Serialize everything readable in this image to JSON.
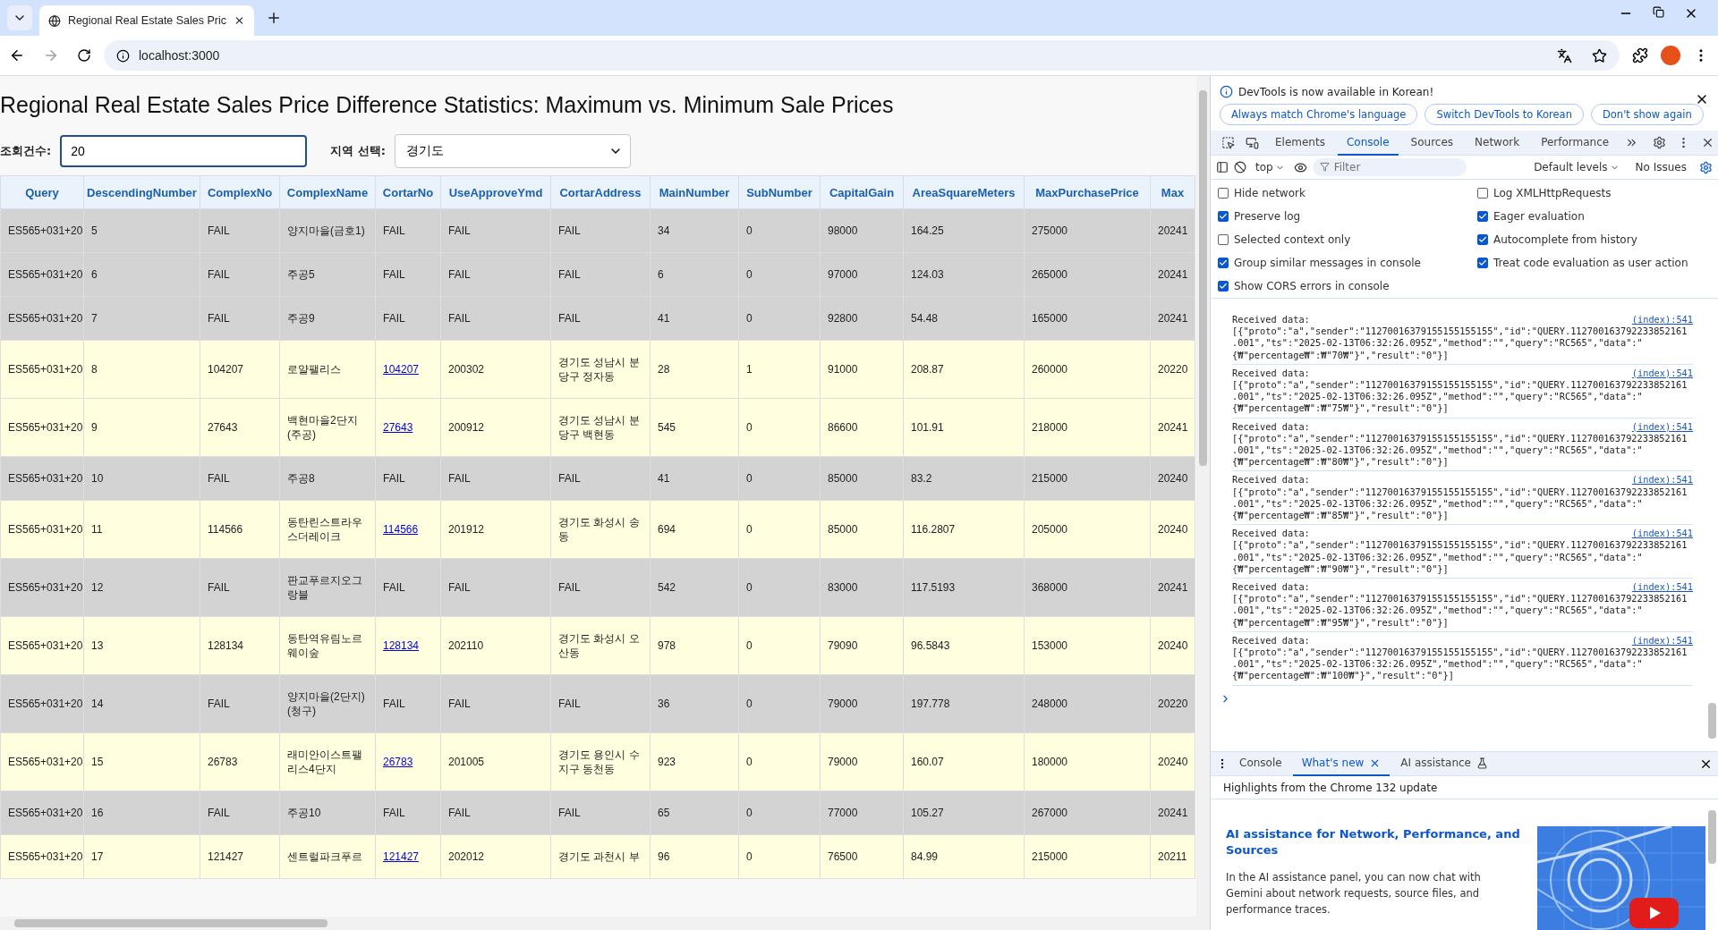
{
  "browser": {
    "tab_title": "Regional Real Estate Sales Pric",
    "url": "localhost:3000"
  },
  "page": {
    "title": "Regional Real Estate Sales Price Difference Statistics: Maximum vs. Minimum Sale Prices",
    "count_label": "조회건수:",
    "count_value": "20",
    "region_label": "지역 선택:",
    "region_value": "경기도"
  },
  "table": {
    "columns": [
      "Query",
      "DescendingNumber",
      "ComplexNo",
      "ComplexName",
      "CortarNo",
      "UseApproveYmd",
      "CortarAddress",
      "MainNumber",
      "SubNumber",
      "CapitalGain",
      "AreaSquareMeters",
      "MaxPurchasePrice",
      "Max"
    ],
    "rows": [
      {
        "kind": "fail",
        "cells": [
          "ES565+031+20",
          "5",
          "FAIL",
          "양지마을(금호1)",
          "FAIL",
          "FAIL",
          "FAIL",
          "34",
          "0",
          "98000",
          "164.25",
          "275000",
          "20241"
        ]
      },
      {
        "kind": "fail",
        "cells": [
          "ES565+031+20",
          "6",
          "FAIL",
          "주공5",
          "FAIL",
          "FAIL",
          "FAIL",
          "6",
          "0",
          "97000",
          "124.03",
          "265000",
          "20241"
        ]
      },
      {
        "kind": "fail",
        "cells": [
          "ES565+031+20",
          "7",
          "FAIL",
          "주공9",
          "FAIL",
          "FAIL",
          "FAIL",
          "41",
          "0",
          "92800",
          "54.48",
          "165000",
          "20241"
        ]
      },
      {
        "kind": "ok",
        "cells": [
          "ES565+031+20",
          "8",
          "104207",
          "로얄팰리스",
          "104207",
          "200302",
          "경기도 성남시 분당구 정자동",
          "28",
          "1",
          "91000",
          "208.87",
          "260000",
          "20220"
        ]
      },
      {
        "kind": "ok",
        "cells": [
          "ES565+031+20",
          "9",
          "27643",
          "백현마을2단지(주공)",
          "27643",
          "200912",
          "경기도 성남시 분당구 백현동",
          "545",
          "0",
          "86600",
          "101.91",
          "218000",
          "20241"
        ]
      },
      {
        "kind": "fail",
        "cells": [
          "ES565+031+20",
          "10",
          "FAIL",
          "주공8",
          "FAIL",
          "FAIL",
          "FAIL",
          "41",
          "0",
          "85000",
          "83.2",
          "215000",
          "20240"
        ]
      },
      {
        "kind": "ok",
        "cells": [
          "ES565+031+20",
          "11",
          "114566",
          "동탄린스트라우스더레이크",
          "114566",
          "201912",
          "경기도 화성시 송동",
          "694",
          "0",
          "85000",
          "116.2807",
          "205000",
          "20240"
        ]
      },
      {
        "kind": "fail",
        "cells": [
          "ES565+031+20",
          "12",
          "FAIL",
          "판교푸르지오그랑블",
          "FAIL",
          "FAIL",
          "FAIL",
          "542",
          "0",
          "83000",
          "117.5193",
          "368000",
          "20241"
        ]
      },
      {
        "kind": "ok",
        "cells": [
          "ES565+031+20",
          "13",
          "128134",
          "동탄역유림노르웨이숲",
          "128134",
          "202110",
          "경기도 화성시 오산동",
          "978",
          "0",
          "79090",
          "96.5843",
          "153000",
          "20240"
        ]
      },
      {
        "kind": "fail",
        "cells": [
          "ES565+031+20",
          "14",
          "FAIL",
          "양지마을(2단지)(청구)",
          "FAIL",
          "FAIL",
          "FAIL",
          "36",
          "0",
          "79000",
          "197.778",
          "248000",
          "20220"
        ]
      },
      {
        "kind": "ok",
        "cells": [
          "ES565+031+20",
          "15",
          "26783",
          "래미안이스트팰리스4단지",
          "26783",
          "201005",
          "경기도 용인시 수지구 동천동",
          "923",
          "0",
          "79000",
          "160.07",
          "180000",
          "20240"
        ]
      },
      {
        "kind": "fail",
        "cells": [
          "ES565+031+20",
          "16",
          "FAIL",
          "주공10",
          "FAIL",
          "FAIL",
          "FAIL",
          "65",
          "0",
          "77000",
          "105.27",
          "267000",
          "20241"
        ]
      },
      {
        "kind": "ok",
        "cells": [
          "ES565+031+20",
          "17",
          "121427",
          "센트럴파크푸르",
          "121427",
          "202012",
          "경기도 과천시 부",
          "96",
          "0",
          "76500",
          "84.99",
          "215000",
          "20211"
        ]
      }
    ]
  },
  "devtools": {
    "infobar": {
      "message": "DevTools is now available in Korean!",
      "buttons": [
        "Always match Chrome's language",
        "Switch DevTools to Korean",
        "Don't show again"
      ]
    },
    "tabs": [
      {
        "label": "Elements",
        "selected": false
      },
      {
        "label": "Console",
        "selected": true
      },
      {
        "label": "Sources",
        "selected": false
      },
      {
        "label": "Network",
        "selected": false
      },
      {
        "label": "Performance",
        "selected": false
      }
    ],
    "toolbar": {
      "context": "top",
      "filter_placeholder": "Filter",
      "levels": "Default levels",
      "issues": "No Issues"
    },
    "settings": [
      {
        "label": "Hide network",
        "checked": false
      },
      {
        "label": "Preserve log",
        "checked": true
      },
      {
        "label": "Selected context only",
        "checked": false
      },
      {
        "label": "Group similar messages in console",
        "checked": true
      },
      {
        "label": "Show CORS errors in console",
        "checked": true
      },
      {
        "label": "Log XMLHttpRequests",
        "checked": false
      },
      {
        "label": "Eager evaluation",
        "checked": true
      },
      {
        "label": "Autocomplete from history",
        "checked": true
      },
      {
        "label": "Treat code evaluation as user action",
        "checked": true
      }
    ],
    "messages": [
      {
        "label": "Received data:",
        "source": "(index):541",
        "lines": [
          "[{\"proto\":\"a\",\"sender\":\"11270016379155155155155\",\"id\":\"QUERY.112700163792233852161",
          ".001\",\"ts\":\"2025-02-13T06:32:26.095Z\",\"method\":\"\",\"query\":\"RC565\",\"data\":\"",
          "{₩\"percentage₩\":₩\"70₩\"}\",\"result\":\"0\"}]"
        ]
      },
      {
        "label": "Received data:",
        "source": "(index):541",
        "lines": [
          "[{\"proto\":\"a\",\"sender\":\"11270016379155155155155\",\"id\":\"QUERY.112700163792233852161",
          ".001\",\"ts\":\"2025-02-13T06:32:26.095Z\",\"method\":\"\",\"query\":\"RC565\",\"data\":\"",
          "{₩\"percentage₩\":₩\"75₩\"}\",\"result\":\"0\"}]"
        ]
      },
      {
        "label": "Received data:",
        "source": "(index):541",
        "lines": [
          "[{\"proto\":\"a\",\"sender\":\"11270016379155155155155\",\"id\":\"QUERY.112700163792233852161",
          ".001\",\"ts\":\"2025-02-13T06:32:26.095Z\",\"method\":\"\",\"query\":\"RC565\",\"data\":\"",
          "{₩\"percentage₩\":₩\"80₩\"}\",\"result\":\"0\"}]"
        ]
      },
      {
        "label": "Received data:",
        "source": "(index):541",
        "lines": [
          "[{\"proto\":\"a\",\"sender\":\"11270016379155155155155\",\"id\":\"QUERY.112700163792233852161",
          ".001\",\"ts\":\"2025-02-13T06:32:26.095Z\",\"method\":\"\",\"query\":\"RC565\",\"data\":\"",
          "{₩\"percentage₩\":₩\"85₩\"}\",\"result\":\"0\"}]"
        ]
      },
      {
        "label": "Received data:",
        "source": "(index):541",
        "lines": [
          "[{\"proto\":\"a\",\"sender\":\"11270016379155155155155\",\"id\":\"QUERY.112700163792233852161",
          ".001\",\"ts\":\"2025-02-13T06:32:26.095Z\",\"method\":\"\",\"query\":\"RC565\",\"data\":\"",
          "{₩\"percentage₩\":₩\"90₩\"}\",\"result\":\"0\"}]"
        ]
      },
      {
        "label": "Received data:",
        "source": "(index):541",
        "lines": [
          "[{\"proto\":\"a\",\"sender\":\"11270016379155155155155\",\"id\":\"QUERY.112700163792233852161",
          ".001\",\"ts\":\"2025-02-13T06:32:26.095Z\",\"method\":\"\",\"query\":\"RC565\",\"data\":\"",
          "{₩\"percentage₩\":₩\"95₩\"}\",\"result\":\"0\"}]"
        ]
      },
      {
        "label": "Received data:",
        "source": "(index):541",
        "lines": [
          "[{\"proto\":\"a\",\"sender\":\"11270016379155155155155\",\"id\":\"QUERY.112700163792233852161",
          ".001\",\"ts\":\"2025-02-13T06:32:26.095Z\",\"method\":\"\",\"query\":\"RC565\",\"data\":\"",
          "{₩\"percentage₩\":₩\"100₩\"}\",\"result\":\"0\"}]"
        ]
      }
    ],
    "drawer": {
      "tabs": [
        {
          "label": "Console",
          "selected": false,
          "kind": "plain"
        },
        {
          "label": "What's new",
          "selected": true,
          "kind": "closable"
        },
        {
          "label": "AI assistance",
          "selected": false,
          "kind": "experiment"
        }
      ],
      "heading": "Highlights from the Chrome 132 update",
      "article": {
        "title": "AI assistance for Network, Performance, and Sources",
        "body": "In the AI assistance panel, you can now chat with Gemini about network requests, source files, and performance traces."
      }
    }
  }
}
